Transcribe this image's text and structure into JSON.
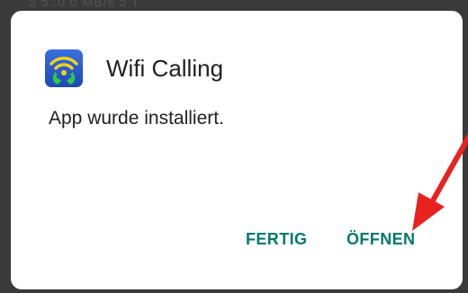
{
  "status_bar": {
    "text": "5 5 .0 0 MB/s   5 T"
  },
  "dialog": {
    "app_icon": "wifi-calling-app-icon",
    "title": "Wifi Calling",
    "message": "App wurde installiert.",
    "buttons": {
      "done_label": "FERTIG",
      "open_label": "ÖFFNEN"
    }
  },
  "annotation": {
    "type": "arrow",
    "points_to": "open-button",
    "color": "#e8231f"
  },
  "colors": {
    "accent": "#00796b",
    "backdrop": "#3a3a3a",
    "dialog_bg": "#ffffff",
    "text": "#202124"
  }
}
